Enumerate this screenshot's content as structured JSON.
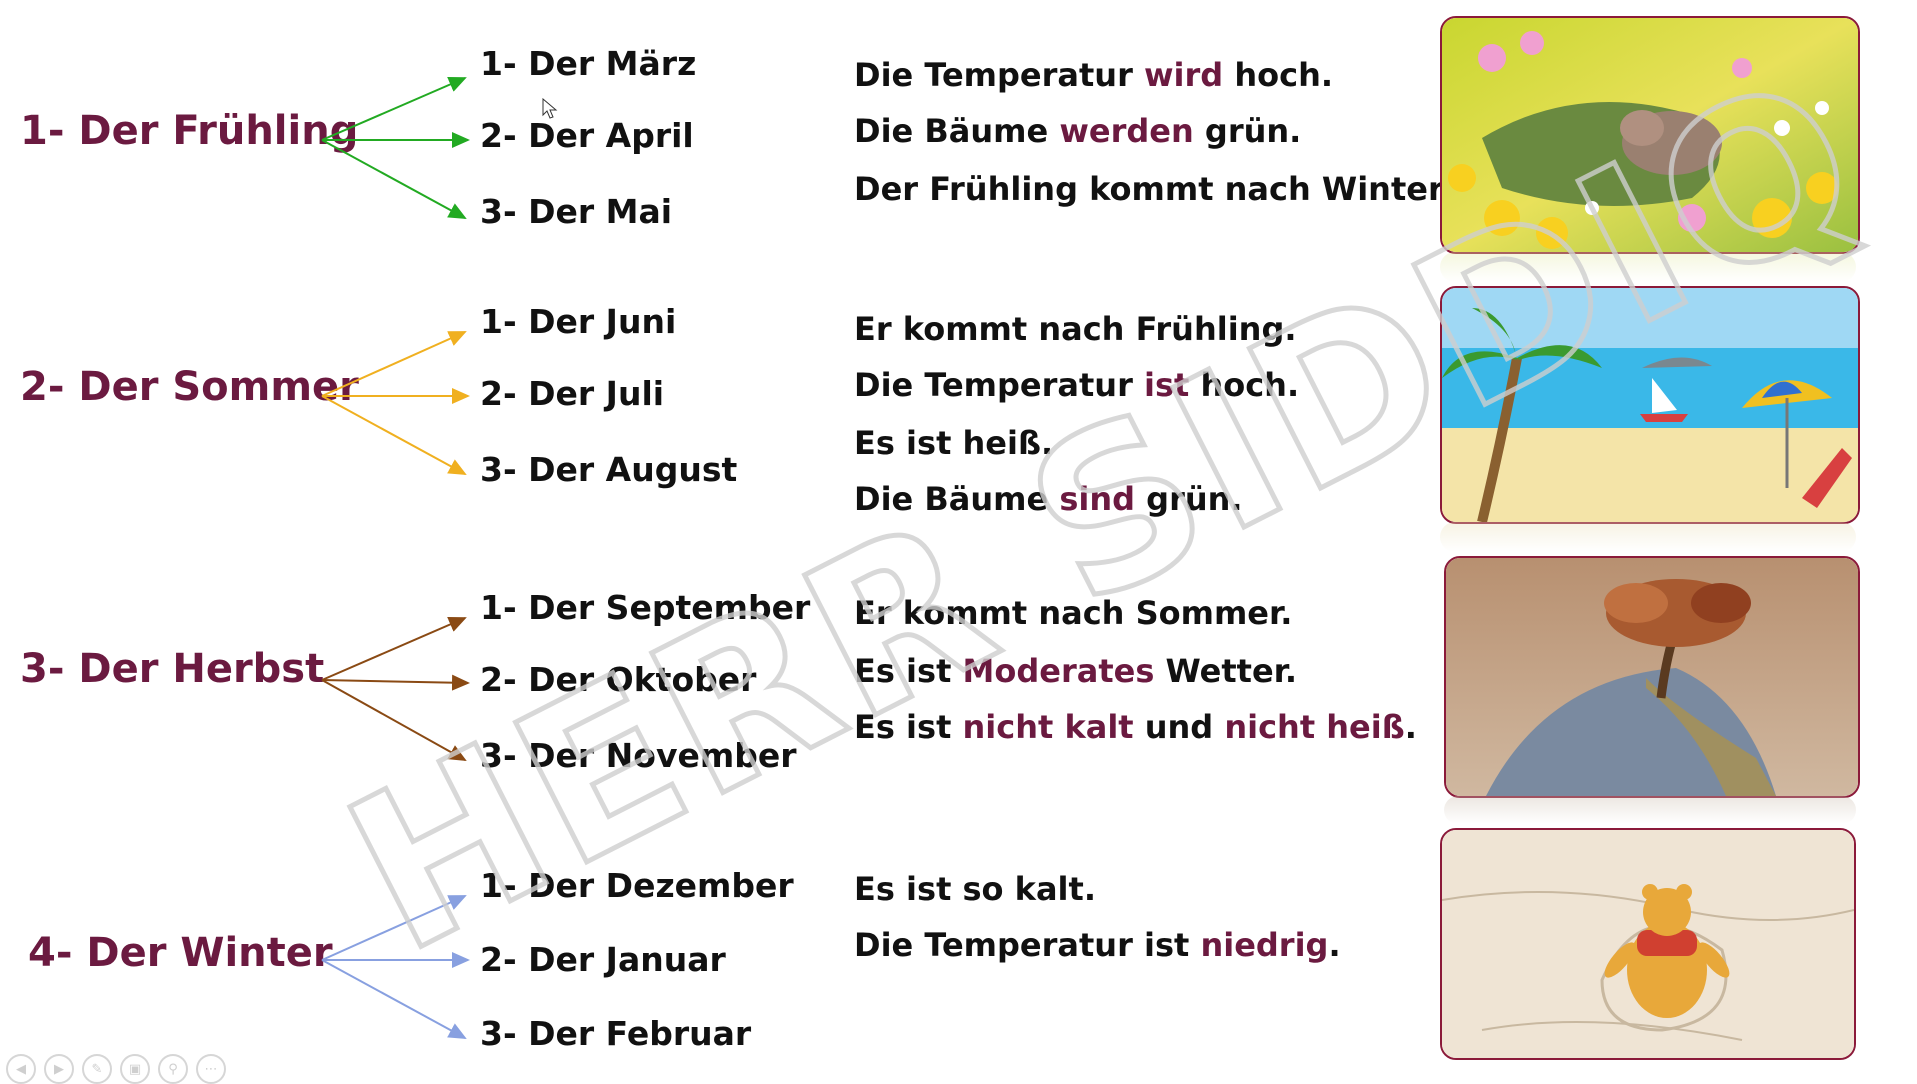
{
  "seasons": [
    {
      "name": "1- Der Frühling",
      "arrow_color": "#22aa22",
      "months": [
        "1- Der März",
        "2- Der April",
        "3- Der Mai"
      ],
      "sentences": [
        [
          {
            "t": "Die Temperatur "
          },
          {
            "t": "wird",
            "h": true
          },
          {
            "t": " hoch."
          }
        ],
        [
          {
            "t": "Die Bäume "
          },
          {
            "t": "werden",
            "h": true
          },
          {
            "t": " grün."
          }
        ],
        [
          {
            "t": "Der Frühling kommt nach Winter."
          }
        ]
      ]
    },
    {
      "name": "2- Der Sommer",
      "arrow_color": "#f0b020",
      "months": [
        "1- Der Juni",
        "2- Der Juli",
        "3- Der August"
      ],
      "sentences": [
        [
          {
            "t": "Er kommt nach Frühling."
          }
        ],
        [
          {
            "t": "Die Temperatur "
          },
          {
            "t": "ist",
            "h": true
          },
          {
            "t": " hoch."
          }
        ],
        [
          {
            "t": "Es ist heiß."
          }
        ],
        [
          {
            "t": "Die Bäume "
          },
          {
            "t": "sind",
            "h": true
          },
          {
            "t": " grün."
          }
        ]
      ]
    },
    {
      "name": "3- Der Herbst",
      "arrow_color": "#8a4a14",
      "months": [
        "1- Der September",
        "2- Der Oktober",
        "3- Der November"
      ],
      "sentences": [
        [
          {
            "t": "Er kommt nach Sommer."
          }
        ],
        [
          {
            "t": "Es ist "
          },
          {
            "t": "Moderates",
            "h": true
          },
          {
            "t": " Wetter."
          }
        ],
        [
          {
            "t": "Es ist "
          },
          {
            "t": "nicht kalt",
            "h": true
          },
          {
            "t": " und "
          },
          {
            "t": "nicht heiß",
            "h": true
          },
          {
            "t": "."
          }
        ]
      ]
    },
    {
      "name": "4- Der Winter",
      "arrow_color": "#88a0e0",
      "months": [
        "1- Der Dezember",
        "2- Der Januar",
        "3- Der Februar"
      ],
      "sentences": [
        [
          {
            "t": "Es ist so kalt."
          }
        ],
        [
          {
            "t": "Die Temperatur ist "
          },
          {
            "t": "niedrig",
            "h": true
          },
          {
            "t": "."
          }
        ]
      ]
    }
  ],
  "watermark": "HERR SIDDIQ",
  "colors": {
    "highlight": "#6b1a40",
    "frame": "#8b1a3a"
  },
  "controls": [
    "prev-icon",
    "next-icon",
    "pen-icon",
    "slides-icon",
    "zoom-icon",
    "more-icon"
  ]
}
